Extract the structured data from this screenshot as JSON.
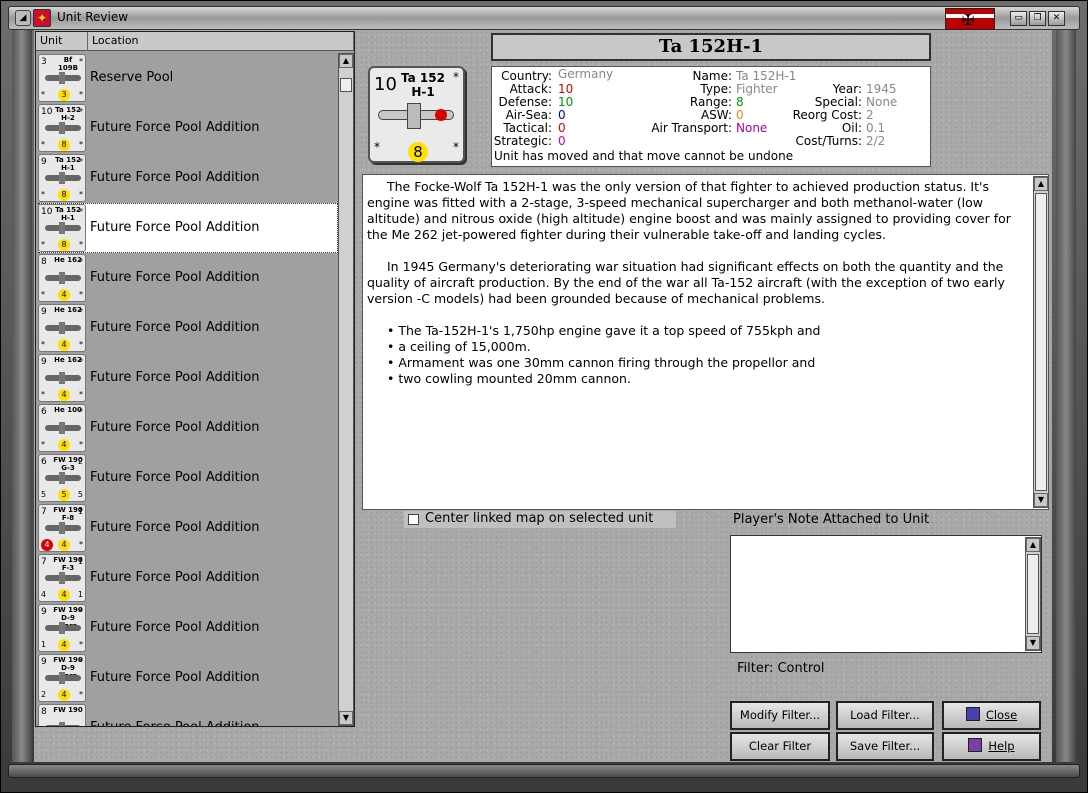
{
  "window": {
    "title": "Unit Review"
  },
  "list": {
    "headers": [
      "Unit",
      "Location"
    ],
    "rows": [
      {
        "atk": "3",
        "name": "Bf 109B",
        "tl": "*",
        "tr": "*",
        "bl": "*",
        "br": "*",
        "dot": "3",
        "red": "",
        "location": "Reserve Pool",
        "selected": false
      },
      {
        "atk": "10",
        "name": "Ta 152 H-2",
        "tl": "*",
        "tr": "*",
        "bl": "*",
        "br": "*",
        "dot": "8",
        "red": "",
        "location": "Future Force Pool Addition",
        "selected": false
      },
      {
        "atk": "9",
        "name": "Ta 152 H-1",
        "tl": "*",
        "tr": "*",
        "bl": "*",
        "br": "*",
        "dot": "8",
        "red": "",
        "location": "Future Force Pool Addition",
        "selected": false
      },
      {
        "atk": "10",
        "name": "Ta 152 H-1",
        "tl": "*",
        "tr": "*",
        "bl": "*",
        "br": "*",
        "dot": "8",
        "red": "",
        "location": "Future Force Pool Addition",
        "selected": true
      },
      {
        "atk": "8",
        "name": "He 162",
        "tl": "*",
        "tr": "*",
        "bl": "*",
        "br": "*",
        "dot": "4",
        "red": "",
        "location": "Future Force Pool Addition",
        "selected": false
      },
      {
        "atk": "9",
        "name": "He 162",
        "tl": "*",
        "tr": "*",
        "bl": "*",
        "br": "*",
        "dot": "4",
        "red": "",
        "location": "Future Force Pool Addition",
        "selected": false
      },
      {
        "atk": "9",
        "name": "He 162",
        "tl": "*",
        "tr": "*",
        "bl": "*",
        "br": "*",
        "dot": "4",
        "red": "",
        "location": "Future Force Pool Addition",
        "selected": false
      },
      {
        "atk": "6",
        "name": "He 100",
        "tl": "*",
        "tr": "*",
        "bl": "*",
        "br": "*",
        "dot": "4",
        "red": "",
        "location": "Future Force Pool Addition",
        "selected": false
      },
      {
        "atk": "6",
        "name": "FW 190 G-3",
        "tl": "",
        "tr": "2",
        "bl": "5",
        "br": "5",
        "dot": "5",
        "red": "",
        "location": "Future Force Pool Addition",
        "selected": false
      },
      {
        "atk": "7",
        "name": "FW 190 F-8",
        "tl": "",
        "tr": "1",
        "bl": "",
        "br": "*",
        "dot": "4",
        "red": "4",
        "location": "Future Force Pool Addition",
        "selected": false
      },
      {
        "atk": "7",
        "name": "FW 190 F-3",
        "tl": "",
        "tr": "1",
        "bl": "4",
        "br": "1",
        "dot": "4",
        "red": "",
        "location": "Future Force Pool Addition",
        "selected": false
      },
      {
        "atk": "9",
        "name": "FW 190 D-9 Dora",
        "tl": "",
        "tr": "*",
        "bl": "1",
        "br": "*",
        "dot": "4",
        "red": "",
        "location": "Future Force Pool Addition",
        "selected": false
      },
      {
        "atk": "9",
        "name": "FW 190 D-9 Dora",
        "tl": "",
        "tr": "*",
        "bl": "2",
        "br": "*",
        "dot": "4",
        "red": "",
        "location": "Future Force Pool Addition",
        "selected": false
      },
      {
        "atk": "8",
        "name": "FW 190",
        "tl": "",
        "tr": "",
        "bl": "",
        "br": "",
        "dot": "",
        "red": "",
        "location": "Future Force Pool Addition",
        "selected": false
      }
    ]
  },
  "unit": {
    "title": "Ta 152H-1",
    "counter": {
      "attack": "10",
      "name_line1": "Ta 152",
      "name_line2": "H-1",
      "star": "*",
      "badge": "8"
    },
    "stats": {
      "country_label": "Country:",
      "country": "Germany",
      "attack_label": "Attack:",
      "attack": "10",
      "defense_label": "Defense:",
      "defense": "10",
      "airsea_label": "Air-Sea:",
      "airsea": "0",
      "tactical_label": "Tactical:",
      "tactical": "0",
      "strategic_label": "Strategic:",
      "strategic": "0",
      "name_label": "Name:",
      "name": "Ta 152H-1",
      "type_label": "Type:",
      "type": "Fighter",
      "range_label": "Range:",
      "range": "8",
      "asw_label": "ASW:",
      "asw": "0",
      "airtransport_label": "Air Transport:",
      "airtransport": "None",
      "year_label": "Year:",
      "year": "1945",
      "special_label": "Special:",
      "special": "None",
      "reorg_label": "Reorg Cost:",
      "reorg": "2",
      "oil_label": "Oil:",
      "oil": "0.1",
      "costturns_label": "Cost/Turns:",
      "costturns": "2/2",
      "moved_note": "Unit has moved and that move cannot be undone"
    },
    "description": {
      "p1": "The Focke-Wolf Ta 152H-1 was the only version of that fighter to achieved production status. It's engine was fitted with a 2-stage, 3-speed mechanical supercharger and both methanol-water (low altitude) and nitrous oxide (high altitude) engine boost and was mainly assigned to providing cover for the Me 262 jet-powered fighter during their vulnerable take-off and landing cycles.",
      "p2": "In 1945 Germany's deteriorating war situation had significant effects on both the quantity and the quality of aircraft production.  By the end of the war all Ta-152 aircraft (with the exception of two early version -C models) had been grounded because of mechanical problems.",
      "bullets": [
        "The Ta-152H-1's 1,750hp engine gave it a top speed of 755kph and",
        "a ceiling of 15,000m.",
        "Armament was one 30mm cannon firing through the propellor and",
        "two cowling mounted 20mm cannon."
      ]
    }
  },
  "controls": {
    "center_map_label": "Center linked map on selected unit",
    "note_label": "Player's Note Attached to Unit",
    "filter_label": "Filter:  Control",
    "modify_filter": "Modify Filter...",
    "load_filter": "Load Filter...",
    "close": "Close",
    "clear_filter": "Clear Filter",
    "save_filter": "Save Filter...",
    "help": "Help"
  },
  "colors": {
    "gray_value": "#888888",
    "attack": "#dd0000",
    "defense": "#009900",
    "naval": "#0000cc",
    "special": "#aa00aa",
    "asw": "#ee8800",
    "badge": "#ffe100"
  }
}
